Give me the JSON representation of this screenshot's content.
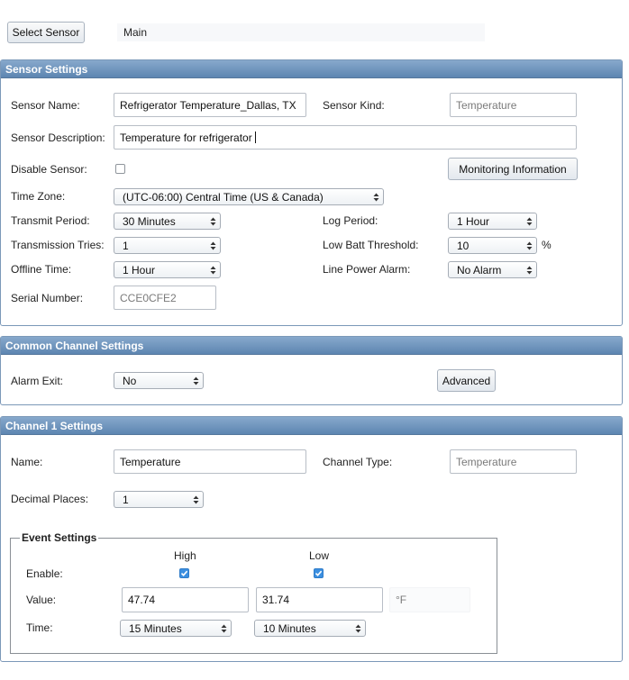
{
  "topbar": {
    "select_sensor_label": "Select Sensor",
    "breadcrumb": "Main"
  },
  "sensor_settings": {
    "header": "Sensor Settings",
    "name_label": "Sensor Name:",
    "name_value": "Refrigerator Temperature_Dallas, TX",
    "kind_label": "Sensor Kind:",
    "kind_value": "Temperature",
    "description_label": "Sensor Description:",
    "description_value": "Temperature for refrigerator",
    "disable_label": "Disable Sensor:",
    "disable_checked": false,
    "monitoring_button": "Monitoring Information",
    "timezone_label": "Time Zone:",
    "timezone_value": "(UTC-06:00) Central Time (US & Canada)",
    "transmit_period_label": "Transmit Period:",
    "transmit_period_value": "30 Minutes",
    "log_period_label": "Log Period:",
    "log_period_value": "1 Hour",
    "transmission_tries_label": "Transmission Tries:",
    "transmission_tries_value": "1",
    "low_batt_label": "Low Batt Threshold:",
    "low_batt_value": "10",
    "low_batt_unit": "%",
    "offline_time_label": "Offline Time:",
    "offline_time_value": "1 Hour",
    "line_power_label": "Line Power Alarm:",
    "line_power_value": "No Alarm",
    "serial_label": "Serial Number:",
    "serial_value": "CCE0CFE2"
  },
  "common_channel": {
    "header": "Common Channel Settings",
    "alarm_exit_label": "Alarm Exit:",
    "alarm_exit_value": "No",
    "advanced_button": "Advanced"
  },
  "channel1": {
    "header": "Channel 1 Settings",
    "name_label": "Name:",
    "name_value": "Temperature",
    "channel_type_label": "Channel Type:",
    "channel_type_value": "Temperature",
    "decimal_label": "Decimal Places:",
    "decimal_value": "1",
    "events": {
      "legend": "Event Settings",
      "high_label": "High",
      "low_label": "Low",
      "enable_label": "Enable:",
      "high_enabled": true,
      "low_enabled": true,
      "value_label": "Value:",
      "high_value": "47.74",
      "low_value": "31.74",
      "unit": "°F",
      "time_label": "Time:",
      "high_time": "15 Minutes",
      "low_time": "10 Minutes"
    }
  },
  "colors": {
    "header_top": "#87a9cc",
    "header_bottom": "#5d85b1",
    "checkbox_checked": "#3b8fe0"
  }
}
